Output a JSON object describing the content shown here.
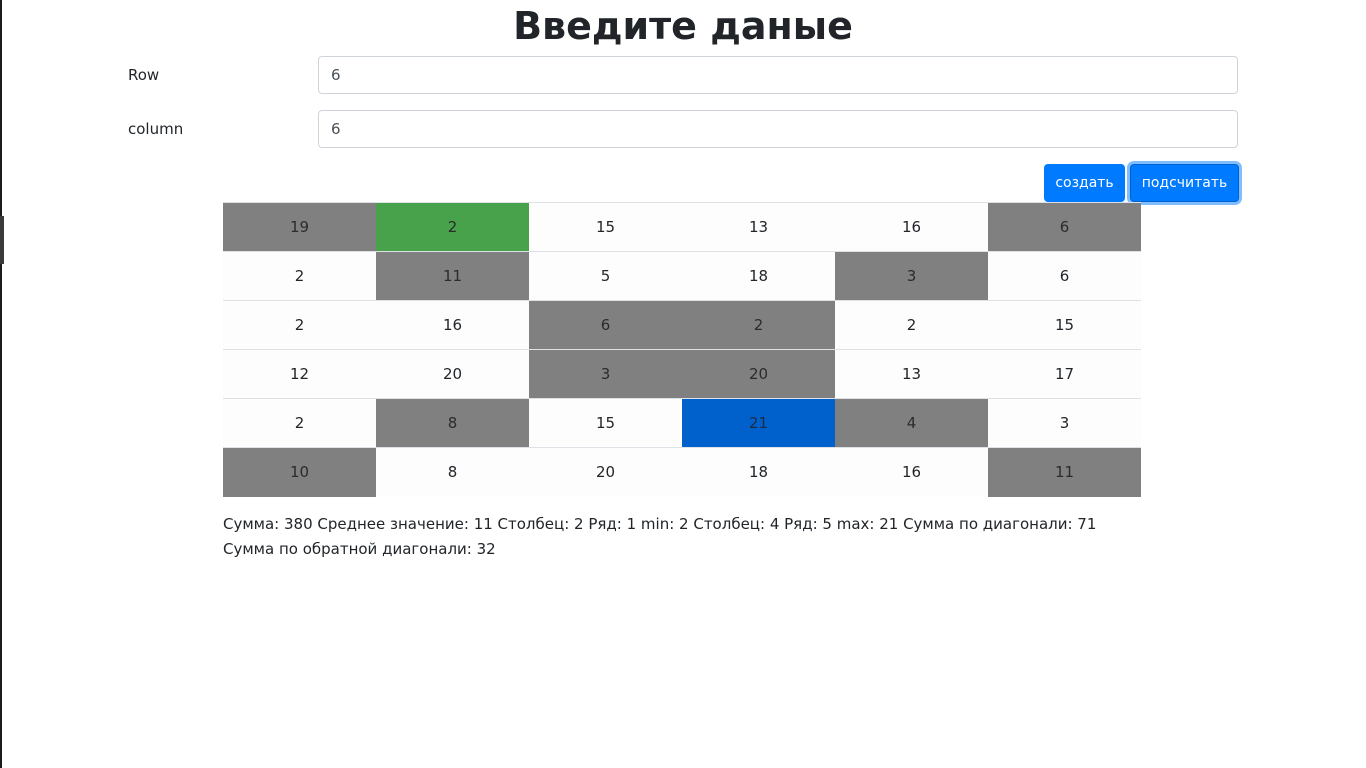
{
  "page": {
    "title": "Введите даные"
  },
  "form": {
    "row": {
      "label": "Row",
      "value": "6"
    },
    "column": {
      "label": "column",
      "value": "6"
    }
  },
  "buttons": {
    "create": "создать",
    "count": "подсчитать"
  },
  "matrix": {
    "rows": [
      [
        19,
        2,
        15,
        13,
        16,
        6
      ],
      [
        2,
        11,
        5,
        18,
        3,
        6
      ],
      [
        2,
        16,
        6,
        2,
        2,
        15
      ],
      [
        12,
        20,
        3,
        20,
        13,
        17
      ],
      [
        2,
        8,
        15,
        21,
        4,
        3
      ],
      [
        10,
        8,
        20,
        18,
        16,
        11
      ]
    ],
    "highlight": {
      "min": {
        "row": 0,
        "col": 1,
        "color": "#47a24b"
      },
      "max": {
        "row": 4,
        "col": 3,
        "color": "#0060cc"
      },
      "diagonal_color": "#808080"
    }
  },
  "stats": {
    "text": "Сумма: 380 Среднее значение: 11 Столбец: 2 Ряд: 1 min: 2 Столбец: 4 Ряд: 5 max: 21 Сумма по диагонали: 71 Сумма по обратной диагонали: 32"
  }
}
